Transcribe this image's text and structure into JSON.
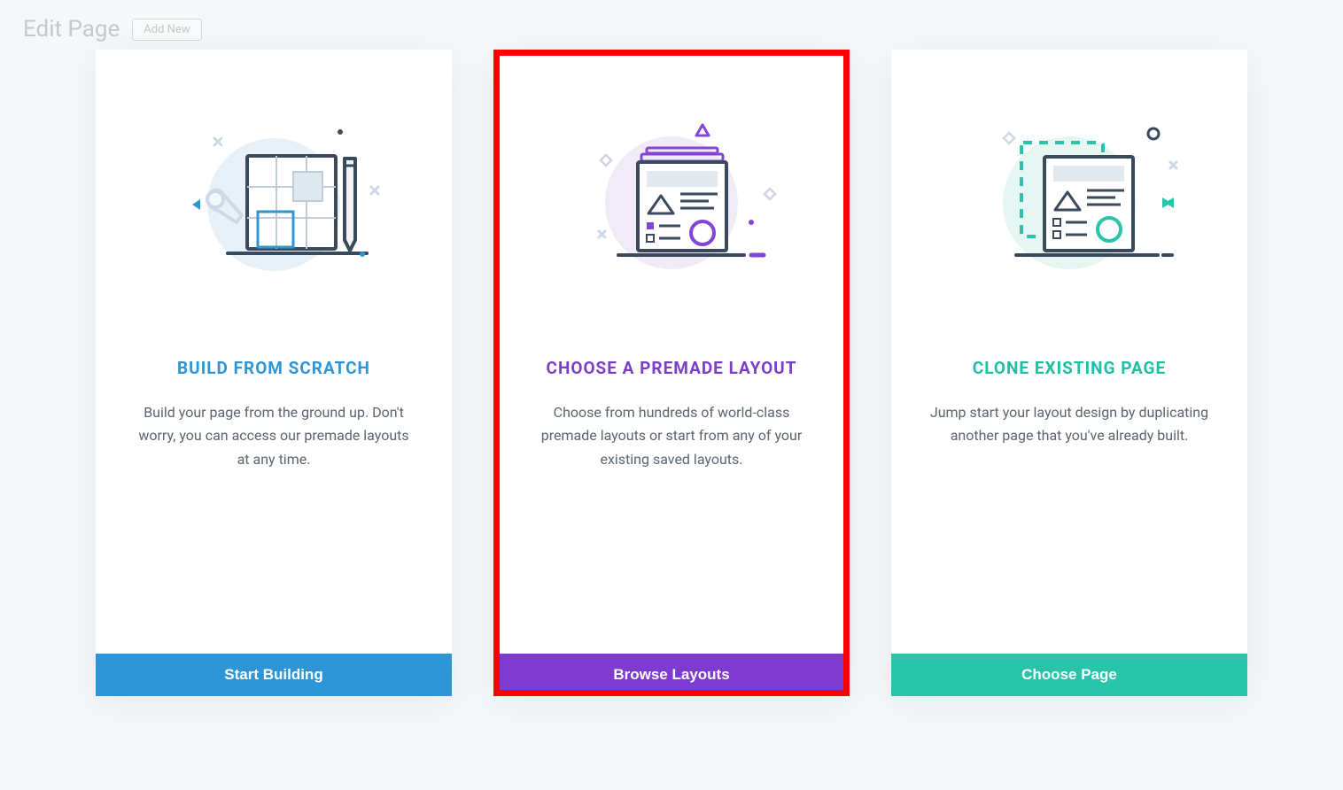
{
  "header": {
    "title": "Edit Page",
    "addNewLabel": "Add New"
  },
  "cards": [
    {
      "title": "BUILD FROM SCRATCH",
      "description": "Build your page from the ground up. Don't worry, you can access our premade layouts at any time.",
      "buttonLabel": "Start Building",
      "color": "blue"
    },
    {
      "title": "CHOOSE A PREMADE LAYOUT",
      "description": "Choose from hundreds of world-class premade layouts or start from any of your existing saved layouts.",
      "buttonLabel": "Browse Layouts",
      "color": "purple",
      "highlighted": true
    },
    {
      "title": "CLONE EXISTING PAGE",
      "description": "Jump start your layout design by duplicating another page that you've already built.",
      "buttonLabel": "Choose Page",
      "color": "teal"
    }
  ]
}
